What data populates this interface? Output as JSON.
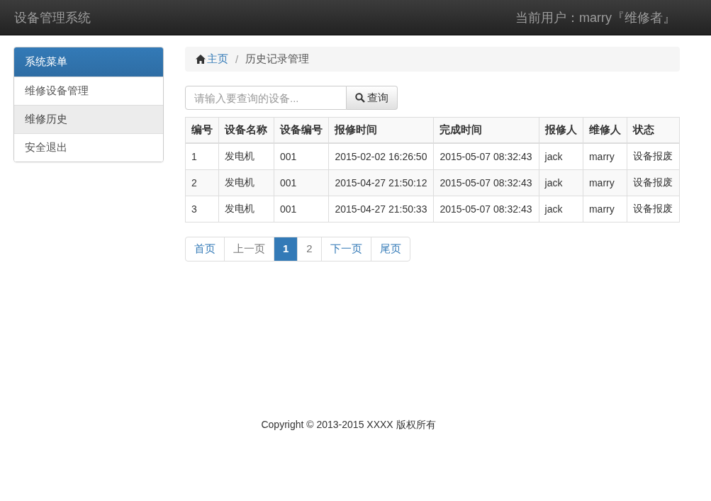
{
  "navbar": {
    "brand": "设备管理系统",
    "user": "当前用户：marry『维修者』"
  },
  "sidebar": {
    "title": "系统菜单",
    "items": [
      {
        "label": "维修设备管理",
        "selected": false
      },
      {
        "label": "维修历史",
        "selected": true
      },
      {
        "label": "安全退出",
        "selected": false
      }
    ]
  },
  "breadcrumb": [
    {
      "label": "主页",
      "kind": "home"
    },
    {
      "label": "/",
      "kind": "separator"
    },
    {
      "label": "历史记录管理",
      "kind": "current"
    }
  ],
  "search": {
    "placeholder": "请输入要查询的设备...",
    "button": "查询"
  },
  "table": {
    "columns": [
      "编号",
      "设备名称",
      "设备编号",
      "报修时间",
      "完成时间",
      "报修人",
      "维修人",
      "状态"
    ],
    "rows": [
      [
        "1",
        "发电机",
        "001",
        "2015-02-02 16:26:50",
        "2015-05-07 08:32:43",
        "jack",
        "marry",
        "设备报废"
      ],
      [
        "2",
        "发电机",
        "001",
        "2015-04-27 21:50:12",
        "2015-05-07 08:32:43",
        "jack",
        "marry",
        "设备报废"
      ],
      [
        "3",
        "发电机",
        "001",
        "2015-04-27 21:50:33",
        "2015-05-07 08:32:43",
        "jack",
        "marry",
        "设备报废"
      ]
    ]
  },
  "pagination": [
    {
      "label": "首页",
      "selected": false,
      "disabled": false
    },
    {
      "label": "上一页",
      "selected": false,
      "disabled": true
    },
    {
      "label": "1",
      "selected": true,
      "disabled": false
    },
    {
      "label": "2",
      "selected": false,
      "disabled": true
    },
    {
      "label": "下一页",
      "selected": false,
      "disabled": false
    },
    {
      "label": "尾页",
      "selected": false,
      "disabled": false
    }
  ],
  "footer": "Copyright © 2013-2015 XXXX 版权所有"
}
